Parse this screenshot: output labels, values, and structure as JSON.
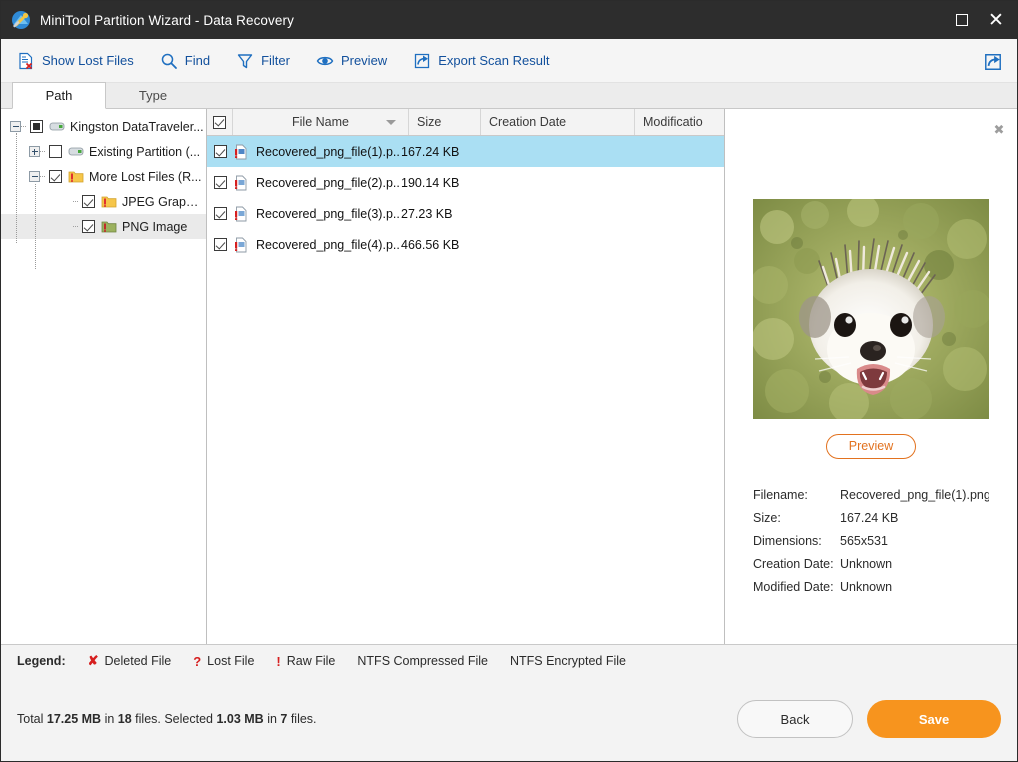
{
  "window": {
    "title": "MiniTool Partition Wizard - Data Recovery",
    "app_icon": "minitool-logo-icon",
    "buttons": [
      {
        "name": "maximize-button",
        "icon": "maximize-icon"
      },
      {
        "name": "close-button",
        "icon": "close-icon"
      }
    ]
  },
  "toolbar": {
    "items": [
      {
        "label": "Show Lost Files",
        "icon": "document-with-x-icon"
      },
      {
        "label": "Find",
        "icon": "search-icon"
      },
      {
        "label": "Filter",
        "icon": "funnel-icon"
      },
      {
        "label": "Preview",
        "icon": "eye-icon"
      },
      {
        "label": "Export Scan Result",
        "icon": "export-arrow-icon"
      }
    ],
    "share": {
      "label": "",
      "icon": "share-export-icon"
    }
  },
  "tabs": [
    {
      "label": "Path",
      "active": true
    },
    {
      "label": "Type",
      "active": false
    }
  ],
  "tree": {
    "nodes": [
      {
        "label": "Kingston DataTraveler...",
        "indent": 0,
        "expander": "minus",
        "check": "partial",
        "icon": "usb-drive-icon",
        "selected": false
      },
      {
        "label": "Existing Partition (...",
        "indent": 1,
        "expander": "plus",
        "check": "unchecked",
        "icon": "partition-drive-icon",
        "selected": false
      },
      {
        "label": "More Lost Files (R...",
        "indent": 1,
        "expander": "minus",
        "check": "checked",
        "icon": "folder-warning-icon",
        "selected": false
      },
      {
        "label": "JPEG Graphics ...",
        "indent": 2,
        "expander": "none",
        "check": "checked",
        "icon": "folder-warning-icon",
        "selected": false
      },
      {
        "label": "PNG Image",
        "indent": 2,
        "expander": "none",
        "check": "checked",
        "icon": "folder-png-icon",
        "selected": true
      }
    ]
  },
  "file_list": {
    "columns": [
      {
        "key": "check",
        "label": "",
        "icon": "header-checkbox-icon"
      },
      {
        "key": "name",
        "label": "File Name",
        "sorted": true,
        "sort_dir": "desc"
      },
      {
        "key": "size",
        "label": "Size"
      },
      {
        "key": "created",
        "label": "Creation Date"
      },
      {
        "key": "modified",
        "label": "Modificatio"
      }
    ],
    "rows": [
      {
        "checked": true,
        "icon": "png-file-raw-icon",
        "name": "Recovered_png_file(1).p...",
        "size": "167.24 KB",
        "created": "",
        "modified": "",
        "selected": true
      },
      {
        "checked": true,
        "icon": "png-file-raw-icon",
        "name": "Recovered_png_file(2).p...",
        "size": "190.14 KB",
        "created": "",
        "modified": "",
        "selected": false
      },
      {
        "checked": true,
        "icon": "png-file-raw-icon",
        "name": "Recovered_png_file(3).p...",
        "size": "27.23 KB",
        "created": "",
        "modified": "",
        "selected": false
      },
      {
        "checked": true,
        "icon": "png-file-raw-icon",
        "name": "Recovered_png_file(4).p...",
        "size": "466.56 KB",
        "created": "",
        "modified": "",
        "selected": false
      }
    ]
  },
  "preview": {
    "close_icon": "close-small-icon",
    "image_alt": "hedgehog-photo",
    "preview_button": "Preview",
    "details": [
      {
        "key": "Filename:",
        "value": "Recovered_png_file(1).png"
      },
      {
        "key": "Size:",
        "value": "167.24 KB"
      },
      {
        "key": "Dimensions:",
        "value": "565x531"
      },
      {
        "key": "Creation Date:",
        "value": "Unknown"
      },
      {
        "key": "Modified Date:",
        "value": "Unknown"
      }
    ]
  },
  "legend": {
    "title": "Legend:",
    "items": [
      {
        "mark": "✘",
        "label": "Deleted File"
      },
      {
        "mark": "?",
        "label": "Lost File"
      },
      {
        "mark": "!",
        "label": "Raw File"
      },
      {
        "mark": "",
        "label": "NTFS Compressed File"
      },
      {
        "mark": "",
        "label": "NTFS Encrypted File"
      }
    ]
  },
  "status": {
    "total_prefix": "Total ",
    "total_size": "17.25 MB",
    "total_mid": " in ",
    "total_count": "18",
    "total_suffix": " files.",
    "selected_prefix": "  Selected ",
    "selected_size": "1.03 MB",
    "selected_mid": " in ",
    "selected_count": "7",
    "selected_suffix": " files."
  },
  "actions": {
    "back": "Back",
    "save": "Save"
  },
  "colors": {
    "titlebar": "#2d2d2d",
    "accent_link": "#12509c",
    "save_button": "#f7941e",
    "preview_button": "#e2721f",
    "row_selected": "#aadff3",
    "legend_mark": "#d61f1f"
  }
}
